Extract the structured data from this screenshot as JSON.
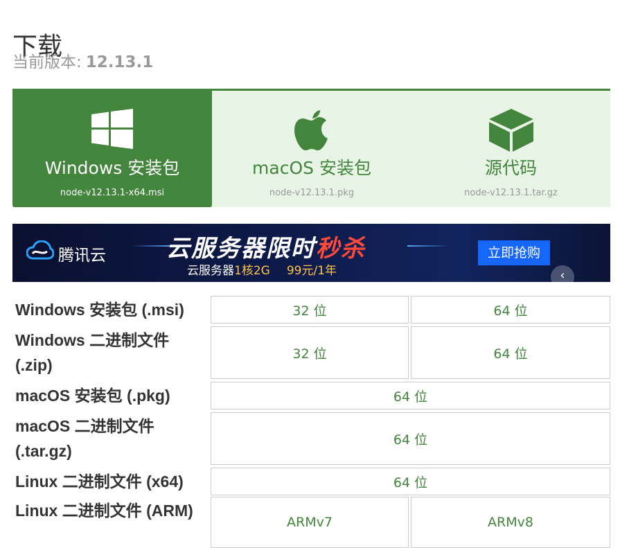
{
  "header": {
    "title": "下载",
    "version_label": "当前版本:",
    "version": "12.13.1"
  },
  "tabs": [
    {
      "label": "Windows 安装包",
      "file": "node-v12.13.1-x64.msi",
      "icon": "windows-icon"
    },
    {
      "label": "macOS 安装包",
      "file": "node-v12.13.1.pkg",
      "icon": "apple-icon"
    },
    {
      "label": "源代码",
      "file": "node-v12.13.1.tar.gz",
      "icon": "cube-icon"
    }
  ],
  "banner": {
    "brand": "腾讯云",
    "headline_main": "云服务器限时",
    "headline_hot": "秒杀",
    "sub_prefix": "云服务器",
    "sub_spec": "1核2G",
    "sub_price": "99元/1年",
    "buy_label": "立即抢购",
    "arrow": "‹"
  },
  "downloads": [
    {
      "label": "Windows 安装包 (.msi)",
      "options": [
        "32 位",
        "64 位"
      ]
    },
    {
      "label": "Windows 二进制文件 (.zip)",
      "options": [
        "32 位",
        "64 位"
      ]
    },
    {
      "label": "macOS 安装包 (.pkg)",
      "options": [
        "64 位"
      ]
    },
    {
      "label": "macOS 二进制文件 (.tar.gz)",
      "options": [
        "64 位"
      ]
    },
    {
      "label": "Linux 二进制文件 (x64)",
      "options": [
        "64 位"
      ]
    },
    {
      "label": "Linux 二进制文件 (ARM)",
      "options": [
        "ARMv7",
        "ARMv8"
      ]
    }
  ],
  "colors": {
    "accent": "#43853d",
    "tab_bg": "#e8f4e6",
    "buy_button": "#1667ff"
  }
}
